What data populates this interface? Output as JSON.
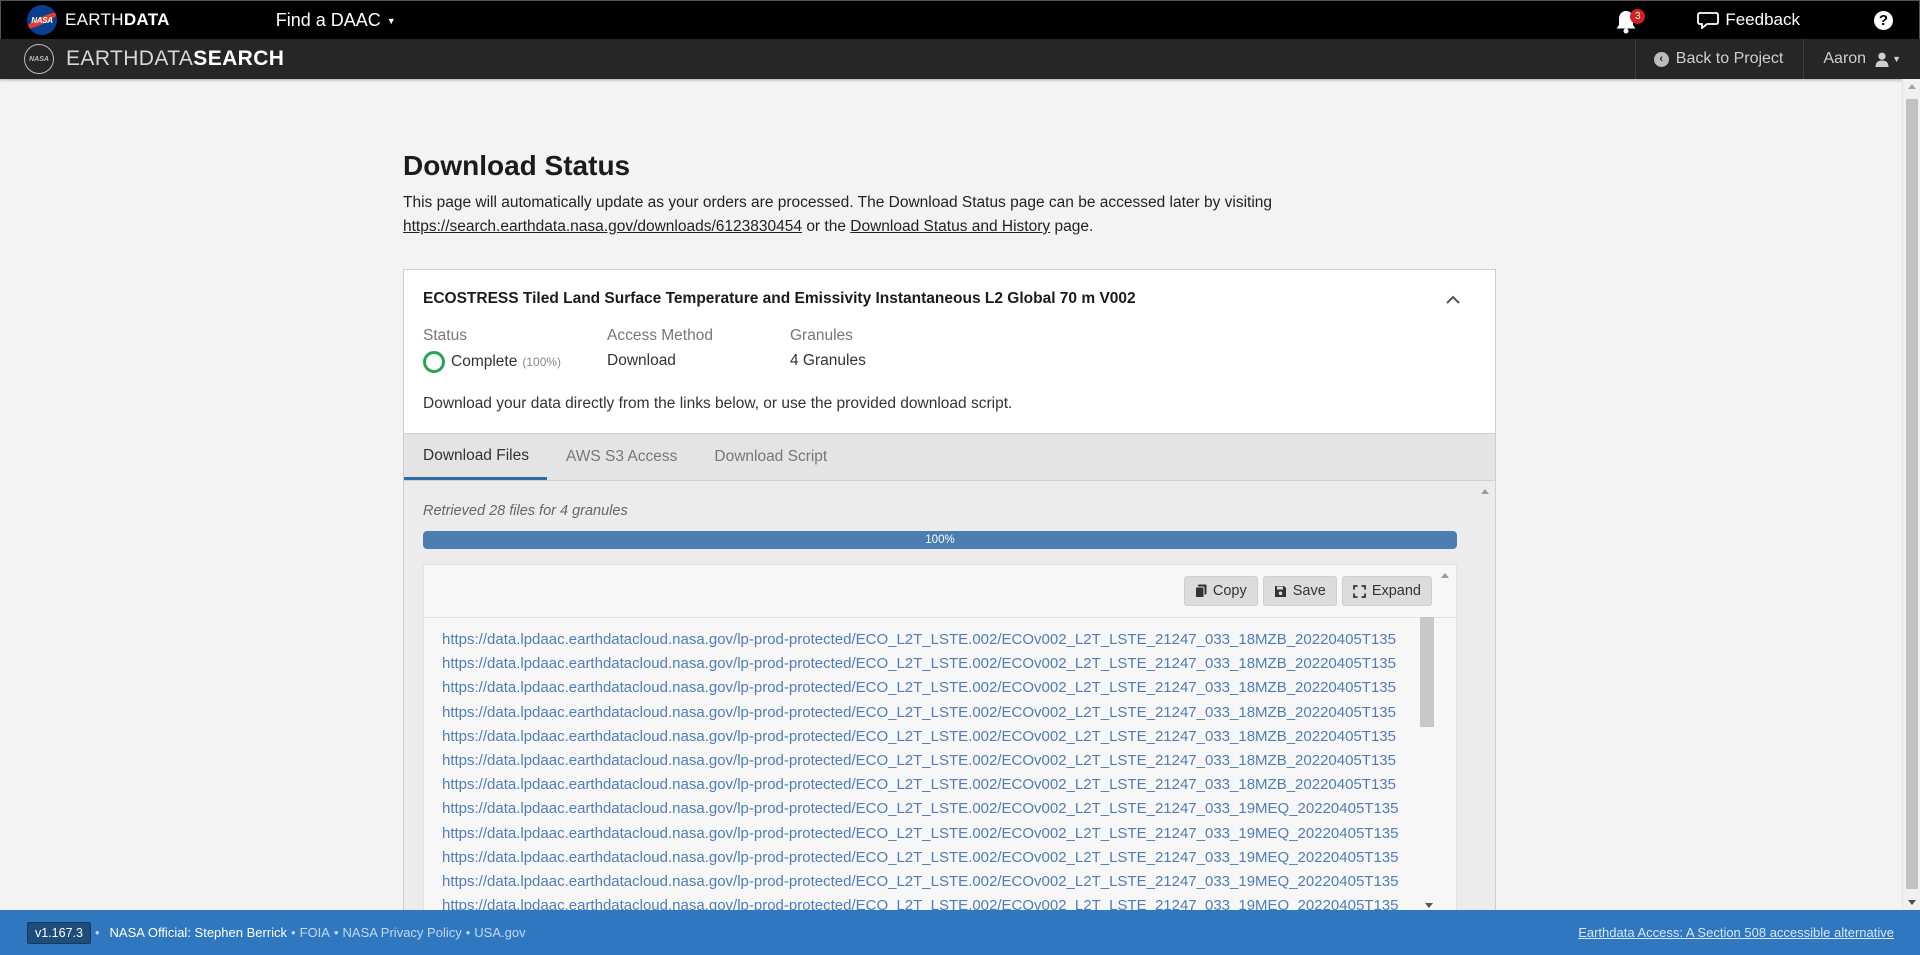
{
  "topbar": {
    "logo_text": "NASA",
    "brand_prefix": "EARTH",
    "brand_suffix": "DATA",
    "find_daac": "Find a DAAC",
    "notification_count": "3",
    "feedback": "Feedback",
    "help": "?"
  },
  "subbar": {
    "logo_text": "NASA",
    "brand_prefix": "EARTHDATA",
    "brand_suffix": "SEARCH",
    "back_to_project": "Back to Project",
    "user": "Aaron"
  },
  "page": {
    "title": "Download Status",
    "intro_text": "This page will automatically update as your orders are processed. The Download Status page can be accessed later by visiting",
    "download_url": "https://search.earthdata.nasa.gov/downloads/6123830454",
    "intro_mid": "or the",
    "history_link": "Download Status and History",
    "intro_end": "page."
  },
  "order": {
    "title": "ECOSTRESS Tiled Land Surface Temperature and Emissivity Instantaneous L2 Global 70 m V002",
    "status_label": "Status",
    "status_value": "Complete",
    "status_pct": "(100%)",
    "access_label": "Access Method",
    "access_value": "Download",
    "granules_label": "Granules",
    "granules_value": "4 Granules",
    "description": "Download your data directly from the links below, or use the provided download script."
  },
  "tabs": [
    {
      "label": "Download Files",
      "active": true
    },
    {
      "label": "AWS S3 Access",
      "active": false
    },
    {
      "label": "Download Script",
      "active": false
    }
  ],
  "files": {
    "retrieved": "Retrieved 28 files for 4 granules",
    "progress_label": "100%",
    "progress_fraction": 1.0,
    "copy": "Copy",
    "save": "Save",
    "expand": "Expand",
    "links": [
      "https://data.lpdaac.earthdatacloud.nasa.gov/lp-prod-protected/ECO_L2T_LSTE.002/ECOv002_L2T_LSTE_21247_033_18MZB_20220405T135",
      "https://data.lpdaac.earthdatacloud.nasa.gov/lp-prod-protected/ECO_L2T_LSTE.002/ECOv002_L2T_LSTE_21247_033_18MZB_20220405T135",
      "https://data.lpdaac.earthdatacloud.nasa.gov/lp-prod-protected/ECO_L2T_LSTE.002/ECOv002_L2T_LSTE_21247_033_18MZB_20220405T135",
      "https://data.lpdaac.earthdatacloud.nasa.gov/lp-prod-protected/ECO_L2T_LSTE.002/ECOv002_L2T_LSTE_21247_033_18MZB_20220405T135",
      "https://data.lpdaac.earthdatacloud.nasa.gov/lp-prod-protected/ECO_L2T_LSTE.002/ECOv002_L2T_LSTE_21247_033_18MZB_20220405T135",
      "https://data.lpdaac.earthdatacloud.nasa.gov/lp-prod-protected/ECO_L2T_LSTE.002/ECOv002_L2T_LSTE_21247_033_18MZB_20220405T135",
      "https://data.lpdaac.earthdatacloud.nasa.gov/lp-prod-protected/ECO_L2T_LSTE.002/ECOv002_L2T_LSTE_21247_033_18MZB_20220405T135",
      "https://data.lpdaac.earthdatacloud.nasa.gov/lp-prod-protected/ECO_L2T_LSTE.002/ECOv002_L2T_LSTE_21247_033_19MEQ_20220405T135",
      "https://data.lpdaac.earthdatacloud.nasa.gov/lp-prod-protected/ECO_L2T_LSTE.002/ECOv002_L2T_LSTE_21247_033_19MEQ_20220405T135",
      "https://data.lpdaac.earthdatacloud.nasa.gov/lp-prod-protected/ECO_L2T_LSTE.002/ECOv002_L2T_LSTE_21247_033_19MEQ_20220405T135",
      "https://data.lpdaac.earthdatacloud.nasa.gov/lp-prod-protected/ECO_L2T_LSTE.002/ECOv002_L2T_LSTE_21247_033_19MEQ_20220405T135",
      "https://data.lpdaac.earthdatacloud.nasa.gov/lp-prod-protected/ECO_L2T_LSTE.002/ECOv002_L2T_LSTE_21247_033_19MEQ_20220405T135"
    ]
  },
  "footer": {
    "version": "v1.167.3",
    "official": "NASA Official: Stephen Berrick",
    "foia": "FOIA",
    "privacy": "NASA Privacy Policy",
    "usa": "USA.gov",
    "accessible": "Earthdata Access: A Section 508 accessible alternative"
  },
  "colors": {
    "accent": "#2f78c0",
    "link": "#4f7db5",
    "complete": "#2aa35a",
    "notification": "#d42020"
  }
}
